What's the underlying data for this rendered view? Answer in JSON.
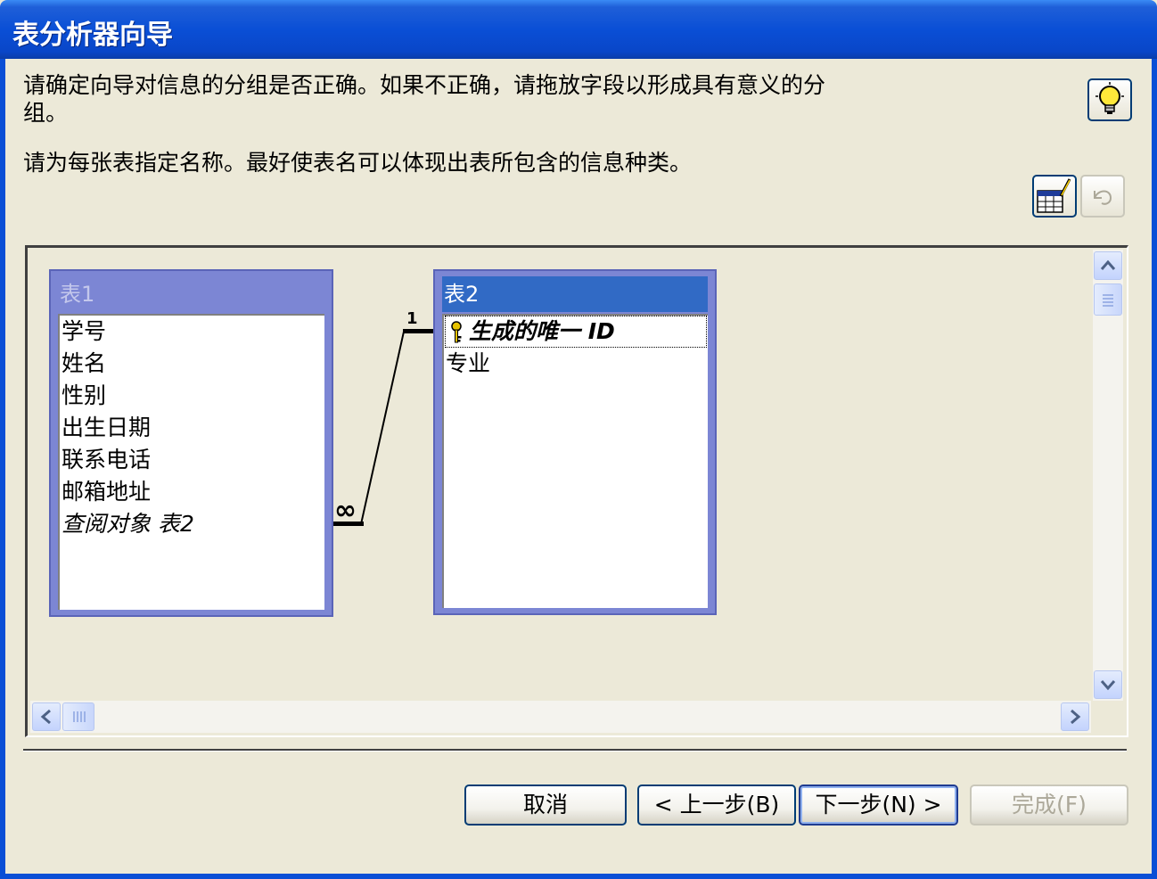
{
  "window": {
    "title": "表分析器向导"
  },
  "instructions": {
    "line1": "请确定向导对信息的分组是否正确。如果不正确，请拖放字段以形成具有意义的分",
    "line2": "组。",
    "line3": "请为每张表指定名称。最好使表名可以体现出表所包含的信息种类。"
  },
  "tables": [
    {
      "name": "表1",
      "selected": false,
      "fields": [
        "学号",
        "姓名",
        "性别",
        "出生日期",
        "联系电话",
        "邮箱地址"
      ],
      "lookup_field": "查阅对象 表2"
    },
    {
      "name": "表2",
      "selected": true,
      "key_field": "生成的唯一 ID",
      "fields": [
        "专业"
      ]
    }
  ],
  "relationship": {
    "one_label": "1",
    "many_label": "∞"
  },
  "buttons": {
    "cancel": "取消",
    "back": "< 上一步(B)",
    "next": "下一步(N) >",
    "finish": "完成(F)"
  },
  "colors": {
    "title_bar": "#0a4fd6",
    "dialog_bg": "#ece9d8",
    "table_frame": "#7c86d4",
    "selected_header": "#316ac5"
  },
  "icons": {
    "tips": "lightbulb-icon",
    "rename": "rename-table-icon",
    "undo": "undo-icon",
    "key": "key-icon"
  }
}
